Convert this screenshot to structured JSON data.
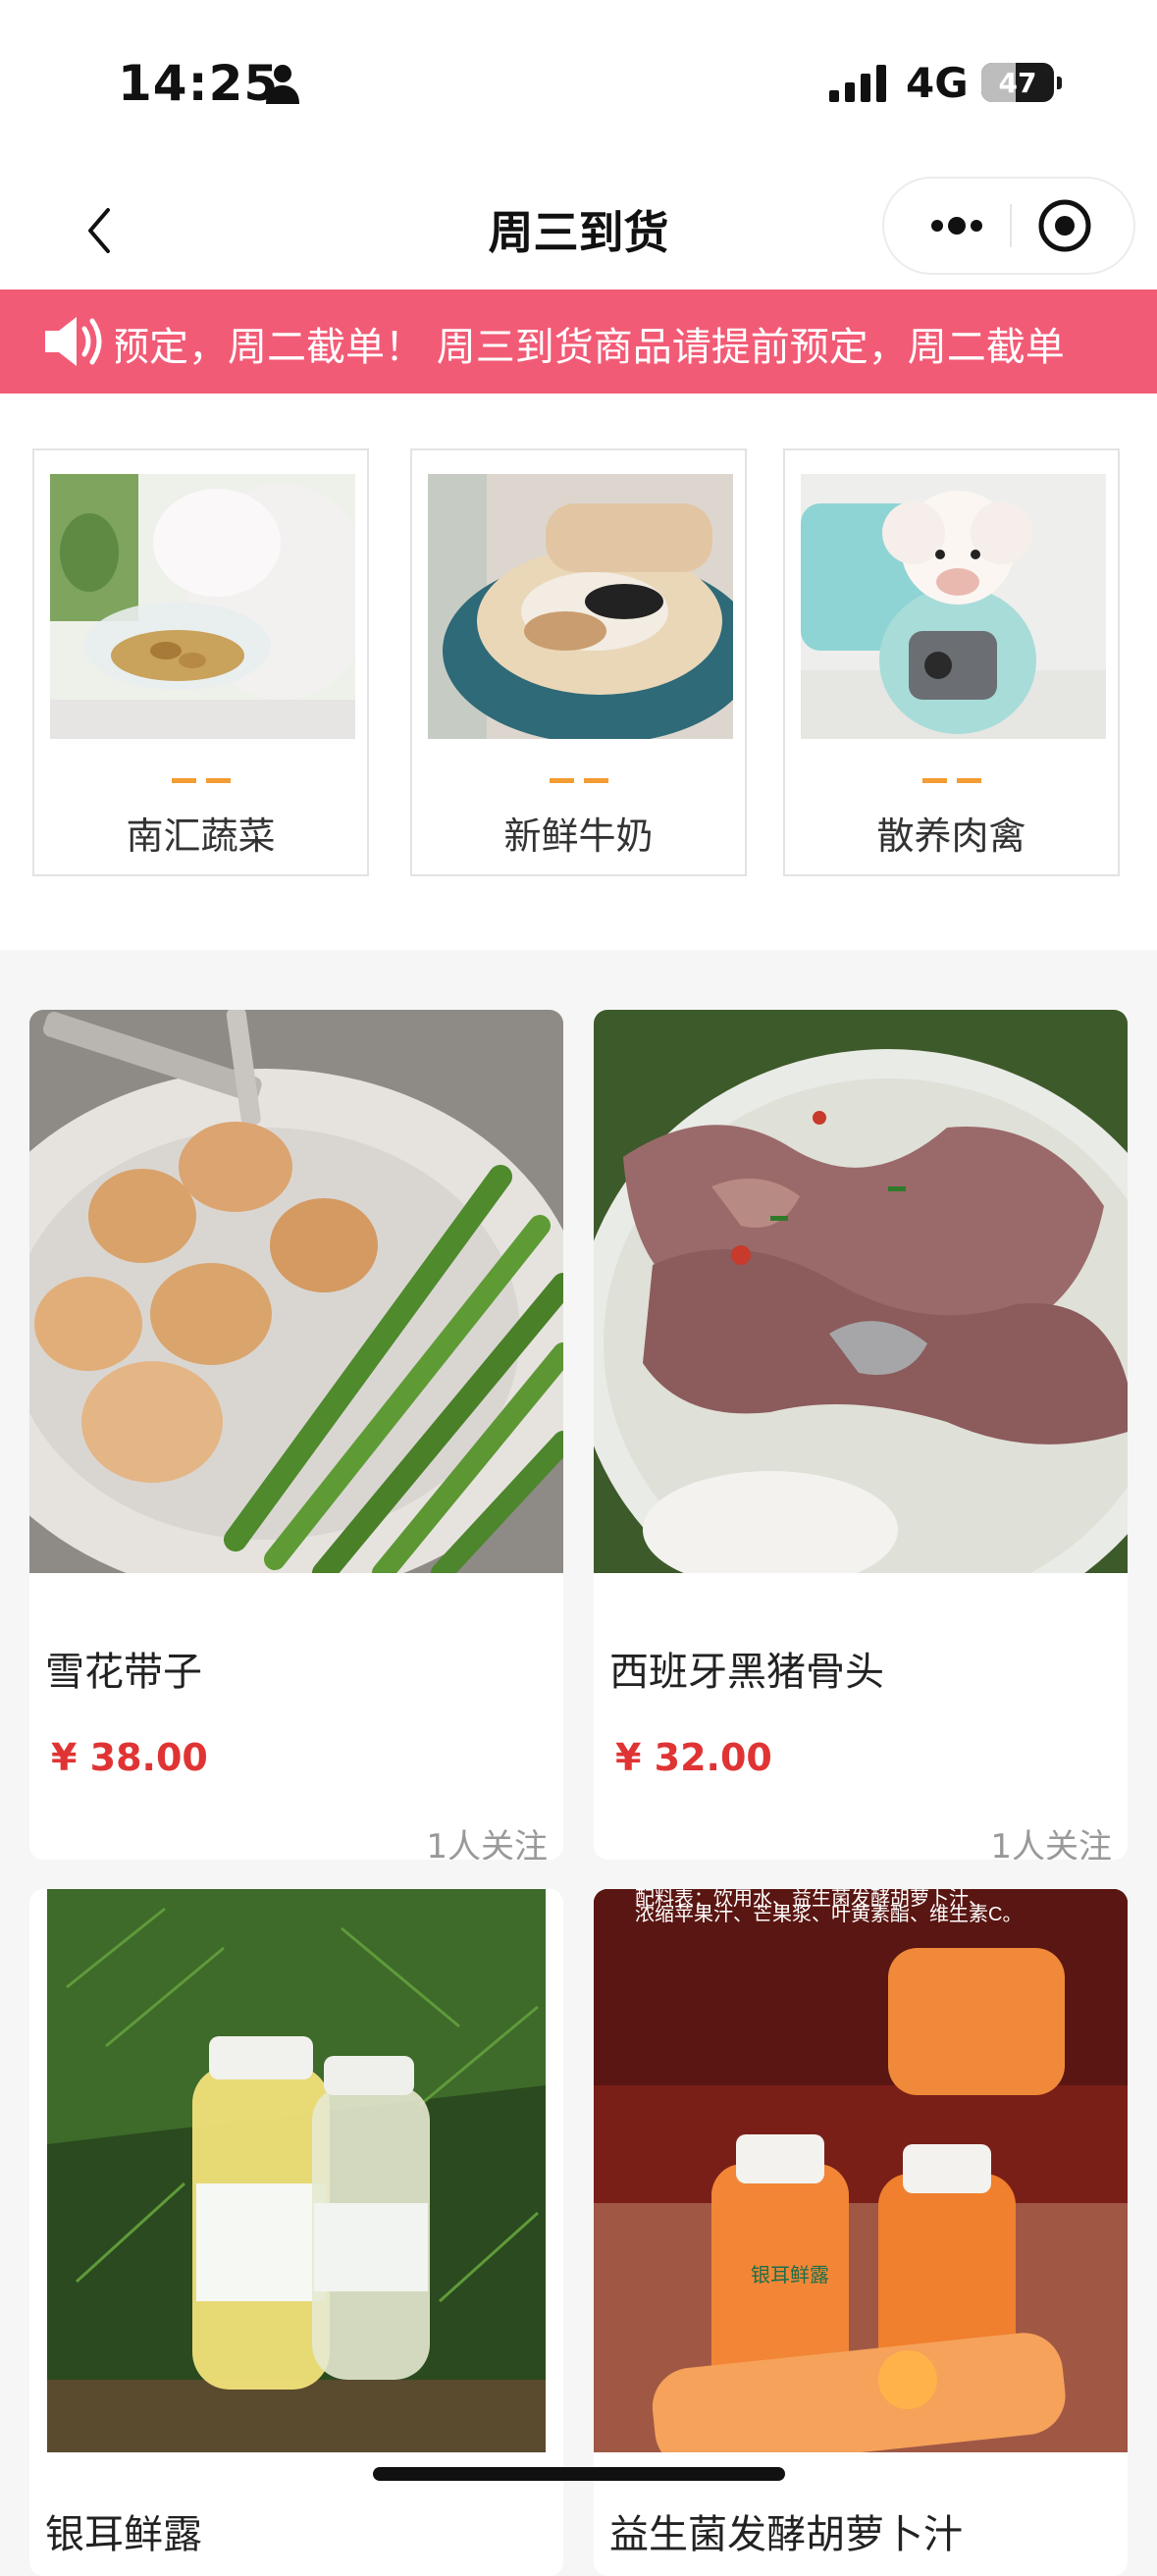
{
  "status_bar": {
    "time": "14:25",
    "network": "4G",
    "battery": "47",
    "battery_level": 0.47
  },
  "nav": {
    "title": "周三到货"
  },
  "notice": {
    "text": "预定，周二截单！    周三到货商品请提前预定，周二截单"
  },
  "categories": [
    {
      "label": "南汇蔬菜",
      "image": "cat-eating-photo"
    },
    {
      "label": "新鲜牛奶",
      "image": "dogs-in-bed-photo"
    },
    {
      "label": "散养肉禽",
      "image": "poodle-in-sweater-photo"
    }
  ],
  "products": [
    {
      "name": "雪花带子",
      "price": "¥ 38.00",
      "follow": "1人关注",
      "image": "scallops-asparagus-photo"
    },
    {
      "name": "西班牙黑猪骨头",
      "price": "¥ 32.00",
      "follow": "1人关注",
      "image": "pork-bone-soup-photo"
    },
    {
      "name": "银耳鲜露",
      "image": "tremella-drink-bottles-photo"
    },
    {
      "name": "益生菌发酵胡萝卜汁",
      "image": "carrot-juice-bottles-photo",
      "image_text_line1": "配料表：饮用水、益生菌发酵胡萝卜汁、",
      "image_text_line2": "浓缩苹果汁、芒果浆、叶黄素酯、维生素C。",
      "bottle_label": "银耳鲜露"
    }
  ],
  "colors": {
    "notice_bg": "#f25b76",
    "price": "#e03434",
    "dash": "#f39c33"
  }
}
